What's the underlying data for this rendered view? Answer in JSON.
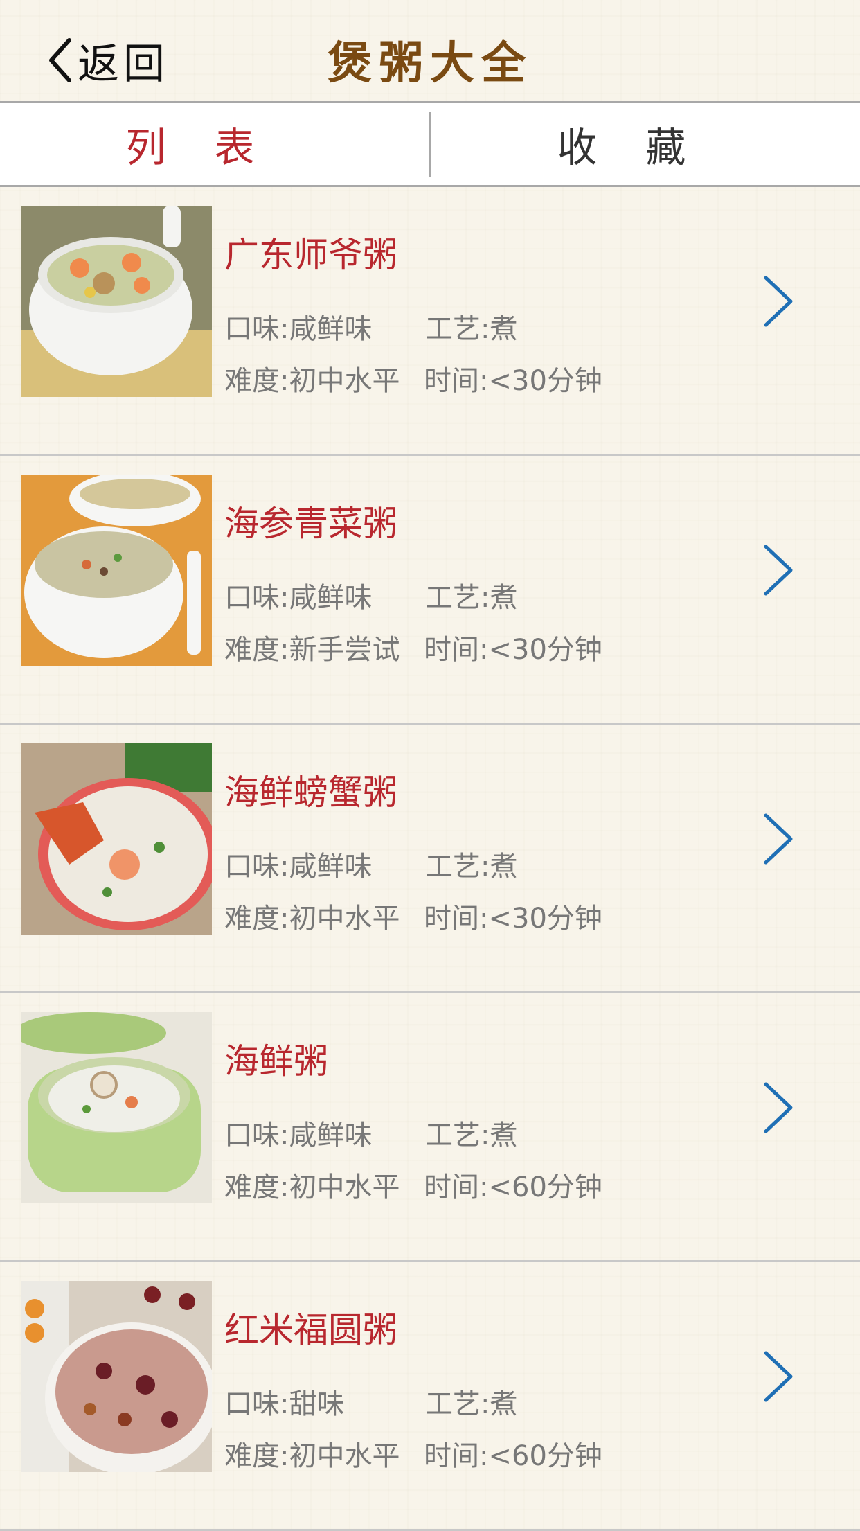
{
  "header": {
    "back_label": "返回",
    "title": "煲粥大全"
  },
  "tabs": [
    {
      "label": "列表",
      "active": true
    },
    {
      "label": "收藏",
      "active": false
    }
  ],
  "colors": {
    "accent": "#b8272e",
    "chevron": "#1f6fb5",
    "title_brown": "#7a4a12"
  },
  "recipes": [
    {
      "name": "广东师爷粥",
      "taste": "口味:咸鲜味",
      "method": "工艺:煮",
      "difficulty": "难度:初中水平",
      "time": "时间:<30分钟"
    },
    {
      "name": "海参青菜粥",
      "taste": "口味:咸鲜味",
      "method": "工艺:煮",
      "difficulty": "难度:新手尝试",
      "time": "时间:<30分钟"
    },
    {
      "name": "海鲜螃蟹粥",
      "taste": "口味:咸鲜味",
      "method": "工艺:煮",
      "difficulty": "难度:初中水平",
      "time": "时间:<30分钟"
    },
    {
      "name": "海鲜粥",
      "taste": "口味:咸鲜味",
      "method": "工艺:煮",
      "difficulty": "难度:初中水平",
      "time": "时间:<60分钟"
    },
    {
      "name": "红米福圆粥",
      "taste": "口味:甜味",
      "method": "工艺:煮",
      "difficulty": "难度:初中水平",
      "time": "时间:<60分钟"
    }
  ]
}
